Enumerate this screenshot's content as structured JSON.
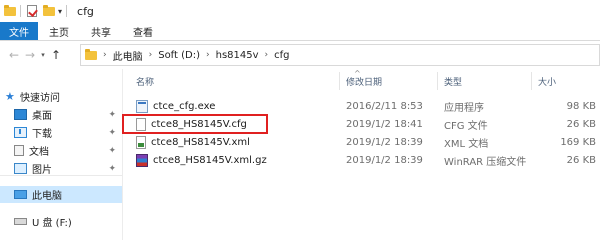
{
  "window": {
    "title": "cfg"
  },
  "ribbon": {
    "tabs": [
      "文件",
      "主页",
      "共享",
      "查看"
    ]
  },
  "address": {
    "crumbs": [
      "此电脑",
      "Soft (D:)",
      "hs8145v",
      "cfg"
    ]
  },
  "sidebar": {
    "quick_access": "快速访问",
    "items": [
      {
        "label": "桌面",
        "icon": "desktop-icon"
      },
      {
        "label": "下载",
        "icon": "download-icon"
      },
      {
        "label": "文档",
        "icon": "documents-icon"
      },
      {
        "label": "图片",
        "icon": "pictures-icon"
      }
    ],
    "this_pc": "此电脑",
    "drive": "U 盘 (F:)"
  },
  "columns": {
    "name": "名称",
    "modified": "修改日期",
    "type": "类型",
    "size": "大小"
  },
  "files": [
    {
      "name": "ctce_cfg.exe",
      "modified": "2016/2/11 8:53",
      "type": "应用程序",
      "size": "98 KB",
      "icon": "exe-icon"
    },
    {
      "name": "ctce8_HS8145V.cfg",
      "modified": "2019/1/2 18:41",
      "type": "CFG 文件",
      "size": "26 KB",
      "icon": "cfg-file-icon"
    },
    {
      "name": "ctce8_HS8145V.xml",
      "modified": "2019/1/2 18:39",
      "type": "XML 文档",
      "size": "169 KB",
      "icon": "xml-file-icon"
    },
    {
      "name": "ctce8_HS8145V.xml.gz",
      "modified": "2019/1/2 18:39",
      "type": "WinRAR 压缩文件",
      "size": "26 KB",
      "icon": "rar-archive-icon"
    }
  ],
  "colors": {
    "file_tab": "#1979ca",
    "highlight": "#e02020",
    "selection": "#cce8ff"
  }
}
